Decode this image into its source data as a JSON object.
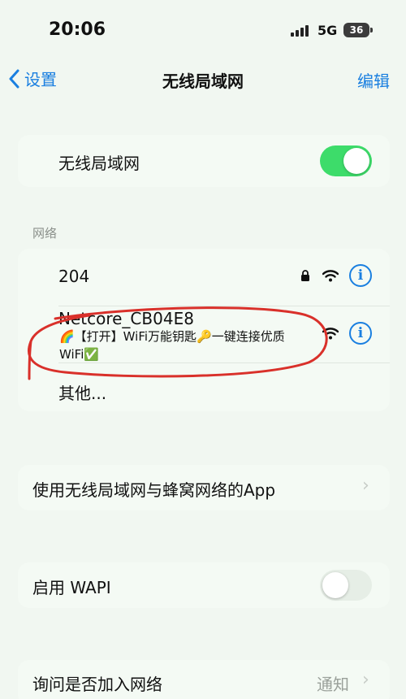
{
  "status_bar": {
    "time": "20:06",
    "network": "5G",
    "battery": "36"
  },
  "nav": {
    "back_label": "设置",
    "title": "无线局域网",
    "edit_label": "编辑"
  },
  "wifi_toggle": {
    "label": "无线局域网",
    "enabled": true
  },
  "networks_section": {
    "header": "网络",
    "items": [
      {
        "name": "204",
        "locked": true
      },
      {
        "name": "Netcore_CB04E8",
        "locked": false
      }
    ],
    "other_label": "其他..."
  },
  "ad_overlay": {
    "line1": "🌈【打开】WiFi万能钥匙🔑一键连接优质",
    "line2": "WiFi✅"
  },
  "apps_row": {
    "label": "使用无线局域网与蜂窝网络的App"
  },
  "wapi_row": {
    "label": "启用 WAPI",
    "enabled": false
  },
  "ask_join_row": {
    "label": "询问是否加入网络",
    "value": "通知"
  },
  "colors": {
    "accent": "#1a7fe0",
    "toggle_on": "#3ddc6a",
    "annotation": "#d9302a"
  }
}
